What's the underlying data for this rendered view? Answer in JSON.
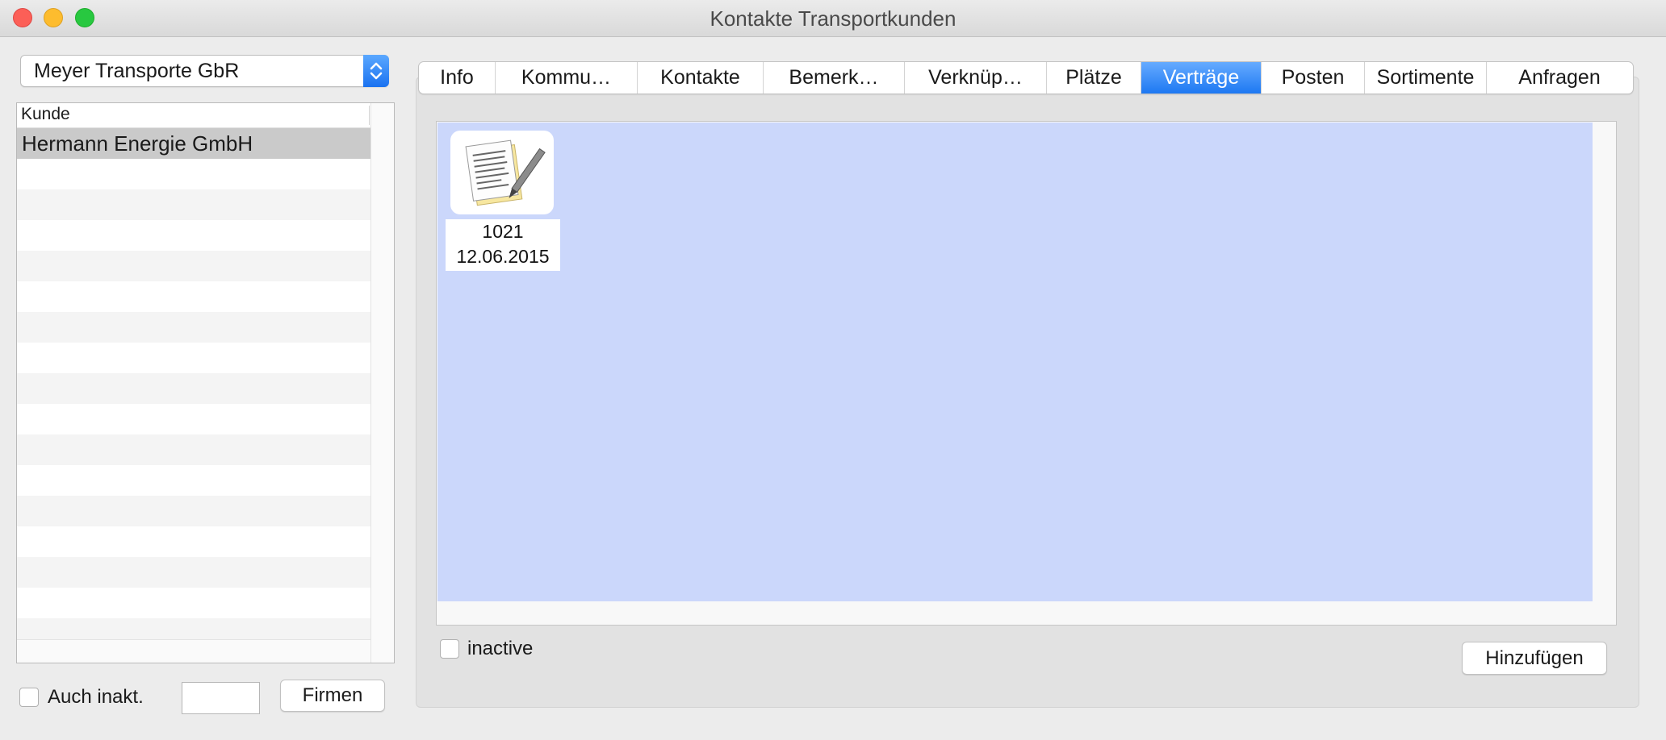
{
  "window": {
    "title": "Kontakte Transportkunden"
  },
  "left": {
    "company_select": {
      "value": "Meyer Transporte GbR"
    },
    "list": {
      "header": "Kunde",
      "rows": [
        "Hermann Energie GmbH",
        "",
        "",
        "",
        "",
        "",
        "",
        "",
        "",
        "",
        "",
        "",
        "",
        "",
        "",
        "",
        ""
      ],
      "selected_index": 0
    },
    "include_inactive_label": "Auch inakt.",
    "filter_value": "",
    "companies_button": "Firmen"
  },
  "tabs": [
    {
      "label": "Info",
      "active": false
    },
    {
      "label": "Kommu…",
      "active": false
    },
    {
      "label": "Kontakte",
      "active": false
    },
    {
      "label": "Bemerk…",
      "active": false
    },
    {
      "label": "Verknüp…",
      "active": false
    },
    {
      "label": "Plätze",
      "active": false
    },
    {
      "label": "Verträge",
      "active": true
    },
    {
      "label": "Posten",
      "active": false
    },
    {
      "label": "Sortimente",
      "active": false
    },
    {
      "label": "Anfragen",
      "active": false
    }
  ],
  "contracts": [
    {
      "number": "1021",
      "date": "12.06.2015",
      "icon": "document-pen-icon"
    }
  ],
  "inactive_label": "inactive",
  "add_button": "Hinzufügen",
  "colors": {
    "accent": "#1d78f2",
    "content_bg": "#cbd7fb",
    "selected_row": "#cacaca"
  }
}
